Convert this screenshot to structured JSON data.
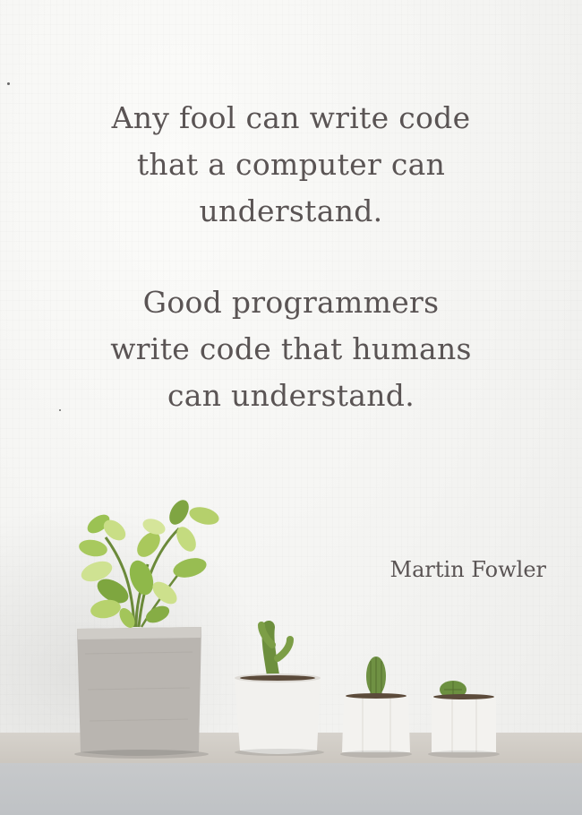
{
  "quote": {
    "line1": "Any fool can write code",
    "line2": "that a computer can",
    "line3": "understand.",
    "line4": "Good programmers",
    "line5": "write code that humans",
    "line6": "can understand."
  },
  "author": "Martin Fowler",
  "colors": {
    "text": "#5a5454",
    "wall": "#f4f4f2",
    "shelf": "#cbc6bf",
    "leaf_green": "#6f9a3a",
    "leaf_light": "#cbe08a",
    "pot_concrete": "#b9b5b0",
    "pot_white": "#f2f1ee"
  }
}
